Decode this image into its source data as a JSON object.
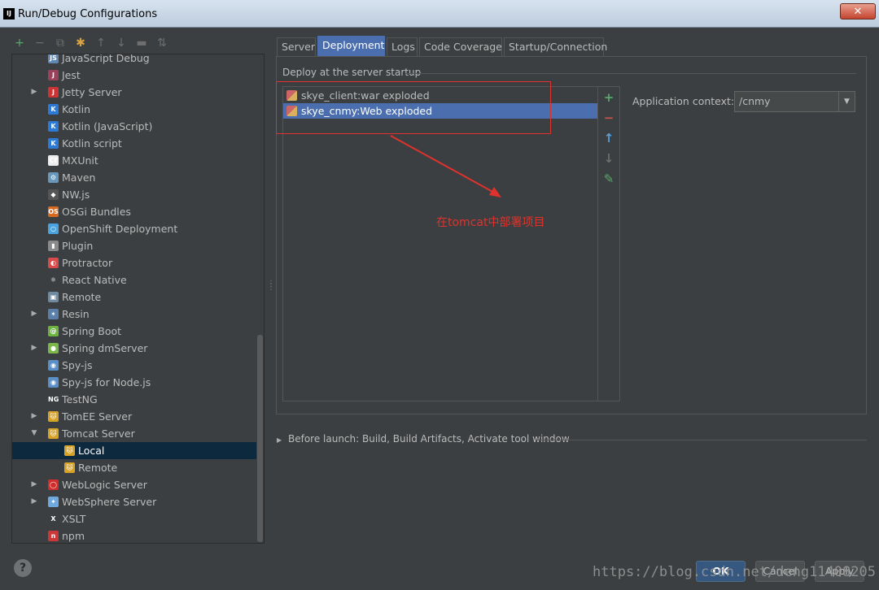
{
  "window": {
    "title": "Run/Debug Configurations",
    "logo": "IJ",
    "close_glyph": "✕"
  },
  "left_toolbar": [
    {
      "name": "add-icon",
      "glyph": "+",
      "color": "#59a869"
    },
    {
      "name": "remove-icon",
      "glyph": "−",
      "color": "#6e6e6e"
    },
    {
      "name": "copy-icon",
      "glyph": "⧉",
      "color": "#6e6e6e"
    },
    {
      "name": "wrench-icon",
      "glyph": "✱",
      "color": "#d9a343"
    },
    {
      "name": "move-up-icon",
      "glyph": "↑",
      "color": "#6e6e6e"
    },
    {
      "name": "move-down-icon",
      "glyph": "↓",
      "color": "#6e6e6e"
    },
    {
      "name": "folder-icon",
      "glyph": "▬",
      "color": "#6e6e6e"
    },
    {
      "name": "sort-icon",
      "glyph": "⇅",
      "color": "#6e6e6e"
    }
  ],
  "tree": [
    {
      "label": "JavaScript Debug",
      "indent": 1,
      "arrow": "",
      "icon": "javascript-debug-icon",
      "color": "#5e87b5",
      "glyph": "JS"
    },
    {
      "label": "Jest",
      "indent": 1,
      "arrow": "",
      "icon": "jest-icon",
      "color": "#99425b",
      "glyph": "J"
    },
    {
      "label": "Jetty Server",
      "indent": 1,
      "arrow": "▶",
      "icon": "jetty-icon",
      "color": "#c33",
      "glyph": "J"
    },
    {
      "label": "Kotlin",
      "indent": 1,
      "arrow": "",
      "icon": "kotlin-icon",
      "color": "#2d7ad6",
      "glyph": "K"
    },
    {
      "label": "Kotlin (JavaScript)",
      "indent": 1,
      "arrow": "",
      "icon": "kotlin-js-icon",
      "color": "#2d7ad6",
      "glyph": "K"
    },
    {
      "label": "Kotlin script",
      "indent": 1,
      "arrow": "",
      "icon": "kotlin-script-icon",
      "color": "#2d7ad6",
      "glyph": "K"
    },
    {
      "label": "MXUnit",
      "indent": 1,
      "arrow": "",
      "icon": "mxunit-icon",
      "color": "#ececec",
      "glyph": "Cf"
    },
    {
      "label": "Maven",
      "indent": 1,
      "arrow": "",
      "icon": "maven-icon",
      "color": "#6897bb",
      "glyph": "⚙"
    },
    {
      "label": "NW.js",
      "indent": 1,
      "arrow": "",
      "icon": "nwjs-icon",
      "color": "#555",
      "glyph": "◆"
    },
    {
      "label": "OSGi Bundles",
      "indent": 1,
      "arrow": "",
      "icon": "osgi-icon",
      "color": "#d66a21",
      "glyph": "OS"
    },
    {
      "label": "OpenShift Deployment",
      "indent": 1,
      "arrow": "",
      "icon": "openshift-icon",
      "color": "#4aa3df",
      "glyph": "○"
    },
    {
      "label": "Plugin",
      "indent": 1,
      "arrow": "",
      "icon": "plugin-icon",
      "color": "#8a8a8a",
      "glyph": "▮"
    },
    {
      "label": "Protractor",
      "indent": 1,
      "arrow": "",
      "icon": "protractor-icon",
      "color": "#d94b4b",
      "glyph": "◐"
    },
    {
      "label": "React Native",
      "indent": 1,
      "arrow": "",
      "icon": "react-icon",
      "color": "#3c3f41",
      "glyph": "⚛"
    },
    {
      "label": "Remote",
      "indent": 1,
      "arrow": "",
      "icon": "remote-icon",
      "color": "#6f8aa3",
      "glyph": "▣"
    },
    {
      "label": "Resin",
      "indent": 1,
      "arrow": "▶",
      "icon": "resin-icon",
      "color": "#5a7fa8",
      "glyph": "✶"
    },
    {
      "label": "Spring Boot",
      "indent": 1,
      "arrow": "",
      "icon": "spring-boot-icon",
      "color": "#6db33f",
      "glyph": "@"
    },
    {
      "label": "Spring dmServer",
      "indent": 1,
      "arrow": "▶",
      "icon": "spring-dm-icon",
      "color": "#7ab648",
      "glyph": "●"
    },
    {
      "label": "Spy-js",
      "indent": 1,
      "arrow": "",
      "icon": "spy-js-icon",
      "color": "#5b8fc7",
      "glyph": "◉"
    },
    {
      "label": "Spy-js for Node.js",
      "indent": 1,
      "arrow": "",
      "icon": "spy-js-node-icon",
      "color": "#5b8fc7",
      "glyph": "◉"
    },
    {
      "label": "TestNG",
      "indent": 1,
      "arrow": "",
      "icon": "testng-icon",
      "color": "#3c3f41",
      "glyph": "NG"
    },
    {
      "label": "TomEE Server",
      "indent": 1,
      "arrow": "▶",
      "icon": "tomee-icon",
      "color": "#d7a326",
      "glyph": "🐱"
    },
    {
      "label": "Tomcat Server",
      "indent": 1,
      "arrow": "▼",
      "icon": "tomcat-icon",
      "color": "#d7a326",
      "glyph": "🐱"
    },
    {
      "label": "Local",
      "indent": 2,
      "arrow": "",
      "icon": "tomcat-local-icon",
      "color": "#d7a326",
      "glyph": "🐱",
      "selected": true
    },
    {
      "label": "Remote",
      "indent": 2,
      "arrow": "",
      "icon": "tomcat-remote-icon",
      "color": "#d7a326",
      "glyph": "🐱"
    },
    {
      "label": "WebLogic Server",
      "indent": 1,
      "arrow": "▶",
      "icon": "weblogic-icon",
      "color": "#d12d2d",
      "glyph": "◯"
    },
    {
      "label": "WebSphere Server",
      "indent": 1,
      "arrow": "▶",
      "icon": "websphere-icon",
      "color": "#6fa8dc",
      "glyph": "✦"
    },
    {
      "label": "XSLT",
      "indent": 1,
      "arrow": "",
      "icon": "xslt-icon",
      "color": "#3c3f41",
      "glyph": "X"
    },
    {
      "label": "npm",
      "indent": 1,
      "arrow": "",
      "icon": "npm-icon",
      "color": "#cb3837",
      "glyph": "n"
    }
  ],
  "tabs": [
    {
      "label": "Server",
      "active": false
    },
    {
      "label": "Deployment",
      "active": true
    },
    {
      "label": "Logs",
      "active": false
    },
    {
      "label": "Code Coverage",
      "active": false
    },
    {
      "label": "Startup/Connection",
      "active": false
    }
  ],
  "deployment": {
    "group_title": "Deploy at the server startup",
    "items": [
      {
        "label": "skye_client:war exploded",
        "selected": false
      },
      {
        "label": "skye_cnmy:Web exploded",
        "selected": true
      }
    ],
    "toolbar": [
      {
        "name": "add-artifact-button",
        "glyph": "+",
        "color": "#59a869"
      },
      {
        "name": "remove-artifact-button",
        "glyph": "−",
        "color": "#c75450"
      },
      {
        "name": "move-up-button",
        "glyph": "↑",
        "color": "#5aa0d8"
      },
      {
        "name": "move-down-button",
        "glyph": "↓",
        "color": "#6e6e6e"
      },
      {
        "name": "edit-artifact-button",
        "glyph": "✎",
        "color": "#59a869"
      }
    ],
    "annotation": "在tomcat中部署项目"
  },
  "application_context": {
    "label": "Application context:",
    "value": "/cnmy"
  },
  "before_launch": {
    "arrow": "▶",
    "label": "Before launch: Build, Build Artifacts, Activate tool window"
  },
  "buttons": {
    "help": "?",
    "ok": "OK",
    "cancel": "Cancel",
    "apply": "Apply"
  },
  "watermark": "https://blog.csdn.net/deng11408205"
}
